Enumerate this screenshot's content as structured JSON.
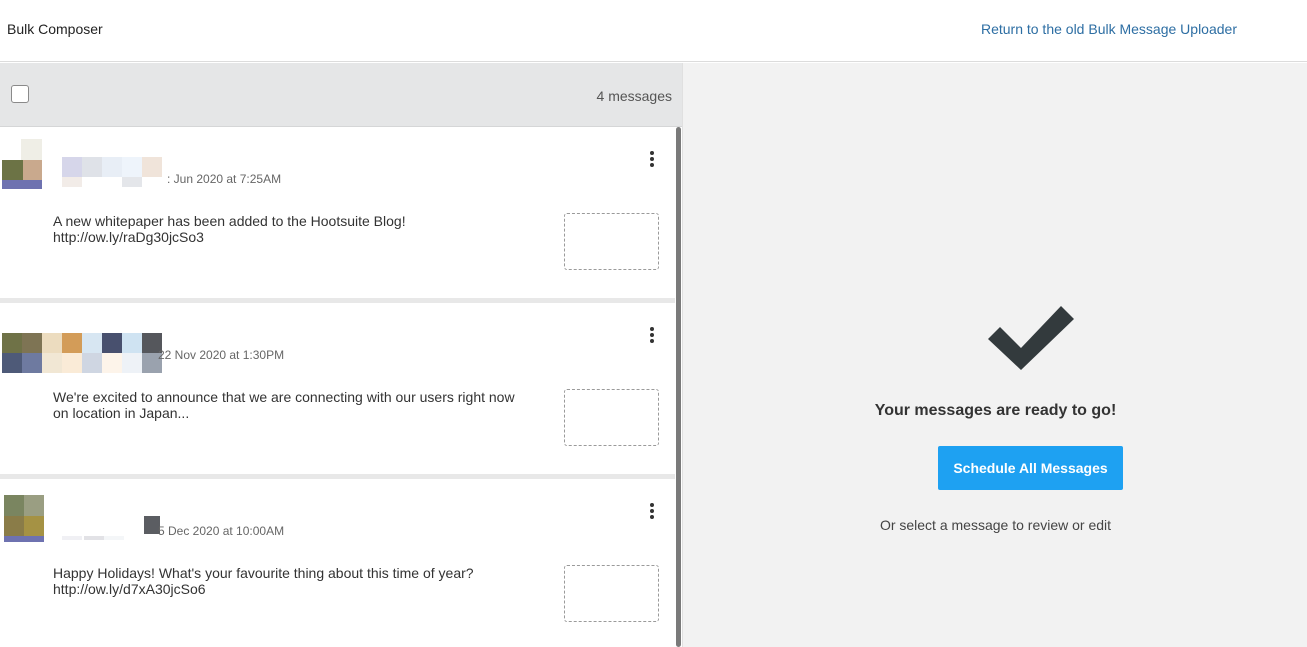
{
  "header": {
    "title": "Bulk Composer",
    "return_link": "Return to the old Bulk Message Uploader"
  },
  "list": {
    "count_label": "4 messages",
    "messages": [
      {
        "timestamp": ": Jun 2020 at 7:25AM",
        "text": "A new whitepaper has been added to the Hootsuite Blog!\nhttp://ow.ly/raDg30jcSo3"
      },
      {
        "timestamp": "22 Nov 2020 at 1:30PM",
        "text": "We're excited to announce that we are connecting with our users right now\non location in Japan..."
      },
      {
        "timestamp": "5 Dec 2020 at 10:00AM",
        "text": "Happy Holidays! What's your favourite thing about this time of year?\nhttp://ow.ly/d7xA30jcSo6"
      }
    ]
  },
  "right_panel": {
    "ready_text": "Your messages are ready to go!",
    "schedule_button": "Schedule All Messages",
    "or_text": "Or select a message to review or edit"
  },
  "colors": {
    "accent_button": "#1ea1f2",
    "link": "#2d6ea3",
    "check_icon": "#333a3d"
  }
}
